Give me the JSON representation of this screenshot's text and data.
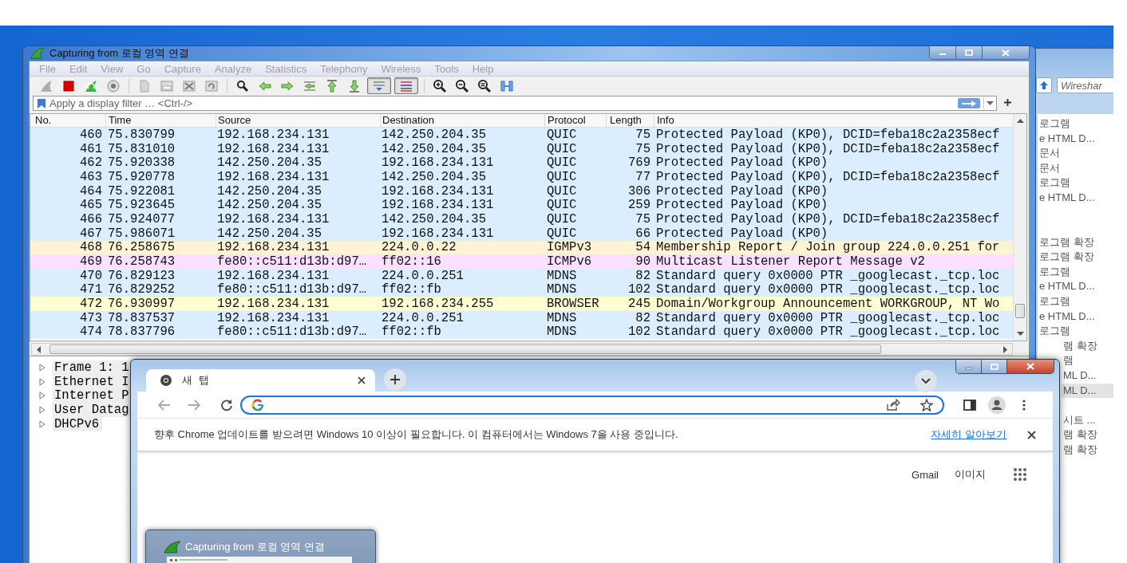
{
  "explorer": {
    "search": {
      "placeholder": "Wireshar"
    },
    "groups": [
      [
        {
          "label": "로그램",
          "selected": false
        },
        {
          "label": "e HTML D...",
          "selected": false
        },
        {
          "label": "문서",
          "selected": false
        },
        {
          "label": "문서",
          "selected": false
        },
        {
          "label": "로그램",
          "selected": false
        },
        {
          "label": "e HTML D...",
          "selected": false
        }
      ],
      [
        {
          "label": "로그램 확장",
          "selected": false
        },
        {
          "label": "로그램 확장",
          "selected": false
        },
        {
          "label": "로그램",
          "selected": false
        },
        {
          "label": "e HTML D...",
          "selected": false
        },
        {
          "label": "로그램",
          "selected": false
        },
        {
          "label": "e HTML D...",
          "selected": false
        },
        {
          "label": "로그램",
          "selected": false
        },
        {
          "label": "램 확장",
          "selected": false
        },
        {
          "label": "램",
          "selected": false
        },
        {
          "label": "ML D...",
          "selected": false
        },
        {
          "label": "ML D...",
          "selected": true
        }
      ],
      [
        {
          "label": "시트 ...",
          "selected": false
        },
        {
          "label": "램 확장",
          "selected": false
        },
        {
          "label": "램 확장",
          "selected": false
        }
      ]
    ]
  },
  "wireshark": {
    "title": "Capturing from 로컬 영역 연결",
    "menu": [
      "File",
      "Edit",
      "View",
      "Go",
      "Capture",
      "Analyze",
      "Statistics",
      "Telephony",
      "Wireless",
      "Tools",
      "Help"
    ],
    "toolbar": [
      {
        "pressed": false
      },
      {
        "pressed": false
      },
      {
        "pressed": false
      },
      {
        "pressed": false
      },
      {
        "pressed": false
      },
      {
        "pressed": false
      },
      {
        "pressed": false
      },
      {
        "pressed": false
      },
      {
        "pressed": false
      },
      {
        "pressed": false
      },
      {
        "pressed": false
      },
      {
        "pressed": false
      },
      {
        "pressed": false
      },
      {
        "pressed": false
      },
      {
        "pressed": true
      },
      {
        "pressed": true
      },
      {
        "pressed": false
      },
      {
        "pressed": false
      },
      {
        "pressed": false
      },
      {
        "pressed": false
      }
    ],
    "filter": {
      "placeholder": "Apply a display filter … <Ctrl-/>"
    },
    "packets": {
      "columns": [
        "No.",
        "Time",
        "Source",
        "Destination",
        "Protocol",
        "Length",
        "Info"
      ],
      "rows": [
        {
          "cells": [
            "460",
            "75.830799",
            "192.168.234.131",
            "142.250.204.35",
            "QUIC",
            "75",
            "Protected Payload (KP0), DCID=feba18c2a2358ecf"
          ],
          "color": "#daeeff"
        },
        {
          "cells": [
            "461",
            "75.831010",
            "192.168.234.131",
            "142.250.204.35",
            "QUIC",
            "75",
            "Protected Payload (KP0), DCID=feba18c2a2358ecf"
          ],
          "color": "#daeeff"
        },
        {
          "cells": [
            "462",
            "75.920338",
            "142.250.204.35",
            "192.168.234.131",
            "QUIC",
            "769",
            "Protected Payload (KP0)"
          ],
          "color": "#daeeff"
        },
        {
          "cells": [
            "463",
            "75.920778",
            "192.168.234.131",
            "142.250.204.35",
            "QUIC",
            "77",
            "Protected Payload (KP0), DCID=feba18c2a2358ecf"
          ],
          "color": "#daeeff"
        },
        {
          "cells": [
            "464",
            "75.922081",
            "142.250.204.35",
            "192.168.234.131",
            "QUIC",
            "306",
            "Protected Payload (KP0)"
          ],
          "color": "#daeeff"
        },
        {
          "cells": [
            "465",
            "75.923645",
            "142.250.204.35",
            "192.168.234.131",
            "QUIC",
            "259",
            "Protected Payload (KP0)"
          ],
          "color": "#daeeff"
        },
        {
          "cells": [
            "466",
            "75.924077",
            "192.168.234.131",
            "142.250.204.35",
            "QUIC",
            "75",
            "Protected Payload (KP0), DCID=feba18c2a2358ecf"
          ],
          "color": "#daeeff"
        },
        {
          "cells": [
            "467",
            "75.986071",
            "142.250.204.35",
            "192.168.234.131",
            "QUIC",
            "66",
            "Protected Payload (KP0)"
          ],
          "color": "#daeeff"
        },
        {
          "cells": [
            "468",
            "76.258675",
            "192.168.234.131",
            "224.0.0.22",
            "IGMPv3",
            "54",
            "Membership Report / Join group 224.0.0.251 for"
          ],
          "color": "#fff3d6"
        },
        {
          "cells": [
            "469",
            "76.258743",
            "fe80::c511:d13b:d97…",
            "ff02::16",
            "ICMPv6",
            "90",
            "Multicast Listener Report Message v2"
          ],
          "color": "#fce0ff"
        },
        {
          "cells": [
            "470",
            "76.829123",
            "192.168.234.131",
            "224.0.0.251",
            "MDNS",
            "82",
            "Standard query 0x0000 PTR _googlecast._tcp.loc"
          ],
          "color": "#daeeff"
        },
        {
          "cells": [
            "471",
            "76.829252",
            "fe80::c511:d13b:d97…",
            "ff02::fb",
            "MDNS",
            "102",
            "Standard query 0x0000 PTR _googlecast._tcp.loc"
          ],
          "color": "#daeeff"
        },
        {
          "cells": [
            "472",
            "76.930997",
            "192.168.234.131",
            "192.168.234.255",
            "BROWSER",
            "245",
            "Domain/Workgroup Announcement WORKGROUP, NT Wo"
          ],
          "color": "#feffd0"
        },
        {
          "cells": [
            "473",
            "78.837537",
            "192.168.234.131",
            "224.0.0.251",
            "MDNS",
            "82",
            "Standard query 0x0000 PTR _googlecast._tcp.loc"
          ],
          "color": "#daeeff"
        },
        {
          "cells": [
            "474",
            "78.837796",
            "fe80::c511:d13b:d97…",
            "ff02::fb",
            "MDNS",
            "102",
            "Standard query 0x0000 PTR _googlecast._tcp.loc"
          ],
          "color": "#daeeff"
        }
      ]
    },
    "details": [
      {
        "label": "Frame 1: 1",
        "expanded": false
      },
      {
        "label": "Ethernet I",
        "expanded": false
      },
      {
        "label": "Internet P",
        "expanded": false
      },
      {
        "label": "User Datag",
        "expanded": false
      },
      {
        "label": "DHCPv6",
        "expanded": false
      }
    ]
  },
  "chrome": {
    "tab": {
      "title": "새 탭"
    },
    "infobar": {
      "message": "향후 Chrome 업데이트를 받으려면 Windows 10 이상이 필요합니다. 이 컴퓨터에서는 Windows 7을 사용 중입니다.",
      "link": "자세히 알아보기"
    },
    "links": [
      "Gmail",
      "이미지"
    ],
    "thumbnail": {
      "title": "Capturing from 로컬 영역 연결"
    }
  }
}
